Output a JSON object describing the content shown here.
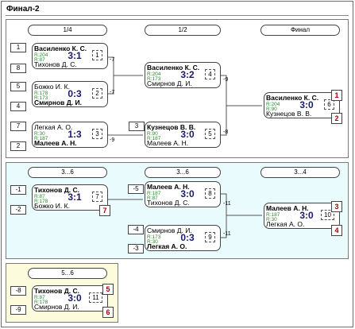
{
  "window": {
    "title": "Финал-2"
  },
  "main": {
    "rounds": [
      "1/4",
      "1/2",
      "Финал"
    ],
    "m1": {
      "p1": "Василенко К. С.",
      "p1_r1": "R:204",
      "p1_r2": "R:87",
      "p2": "Тихонов Д. С.",
      "score": "3:1",
      "num": "1",
      "seed1": "1",
      "seed2": "8"
    },
    "m2": {
      "p1": "Божко И. К.",
      "p1_r1": "R:178",
      "p1_r2": "R:173",
      "p2": "Смирнов Д. И.",
      "score": "0:3",
      "num": "2",
      "seed1": "5",
      "seed2": "4"
    },
    "m3": {
      "p1": "Легкая А. О.",
      "p1_r1": "R:30",
      "p1_r2": "R:187",
      "p2": "Малеев А. Н.",
      "score": "1:3",
      "num": "3",
      "seed1": "7",
      "seed2": "2"
    },
    "m4": {
      "p1": "Василенко К. С.",
      "p1_r1": "R:204",
      "p1_r2": "R:173",
      "p2": "Смирнов Д. И.",
      "score": "3:2",
      "num": "4"
    },
    "m5": {
      "p1": "Кузнецов В. В.",
      "p1_r1": "R:90",
      "p1_r2": "R:187",
      "p2": "Малеев А. Н.",
      "score": "3:0",
      "num": "5",
      "seed1": "3"
    },
    "m6": {
      "p1": "Василенко К. С.",
      "p1_r1": "R:204",
      "p1_r2": "R:90",
      "p2": "Кузнецов В. В.",
      "score": "3:0",
      "num": "6",
      "place1": "1",
      "place2": "2"
    },
    "losers": {
      "l1": "-7",
      "l2": "-7",
      "l3": "-9",
      "l4": "-9",
      "l5": "-8"
    }
  },
  "consolation": {
    "rounds": [
      "3...6",
      "3...6",
      "3...4"
    ],
    "m7": {
      "p1": "Тихонов Д. С.",
      "p1_r1": "R:87",
      "p1_r2": "R:178",
      "p2": "Божко И. К.",
      "score": "3:1",
      "num": "7",
      "seed1": "-1",
      "seed2": "-2"
    },
    "m8": {
      "p1": "Малеев А. Н.",
      "p1_r1": "R:187",
      "p1_r2": "R:87",
      "p2": "Тихонов Д. С.",
      "score": "3:0",
      "num": "8",
      "seed1": "-5"
    },
    "m9": {
      "p1": "Смирнов Д. И.",
      "p1_r1": "R:173",
      "p1_r2": "R:30",
      "p2": "Легкая А. О.",
      "score": "0:3",
      "num": "9",
      "seed1": "-4",
      "seed2": "-3"
    },
    "m10": {
      "p1": "Малеев А. Н.",
      "p1_r1": "R:187",
      "p1_r2": "R:30",
      "p2": "Легкая А. О.",
      "score": "3:0",
      "num": "10",
      "place1": "3",
      "place2": "4"
    },
    "losers": {
      "l1": "-11",
      "l2": "-11"
    }
  },
  "fifth": {
    "round": "5...6",
    "m11": {
      "p1": "Тихонов Д. С.",
      "p1_r1": "R:87",
      "p1_r2": "R:178",
      "p2": "Смирнов Д. И.",
      "score": "3:0",
      "num": "11",
      "seed1": "-8",
      "seed2": "-9",
      "place1": "5",
      "place2": "6"
    }
  }
}
